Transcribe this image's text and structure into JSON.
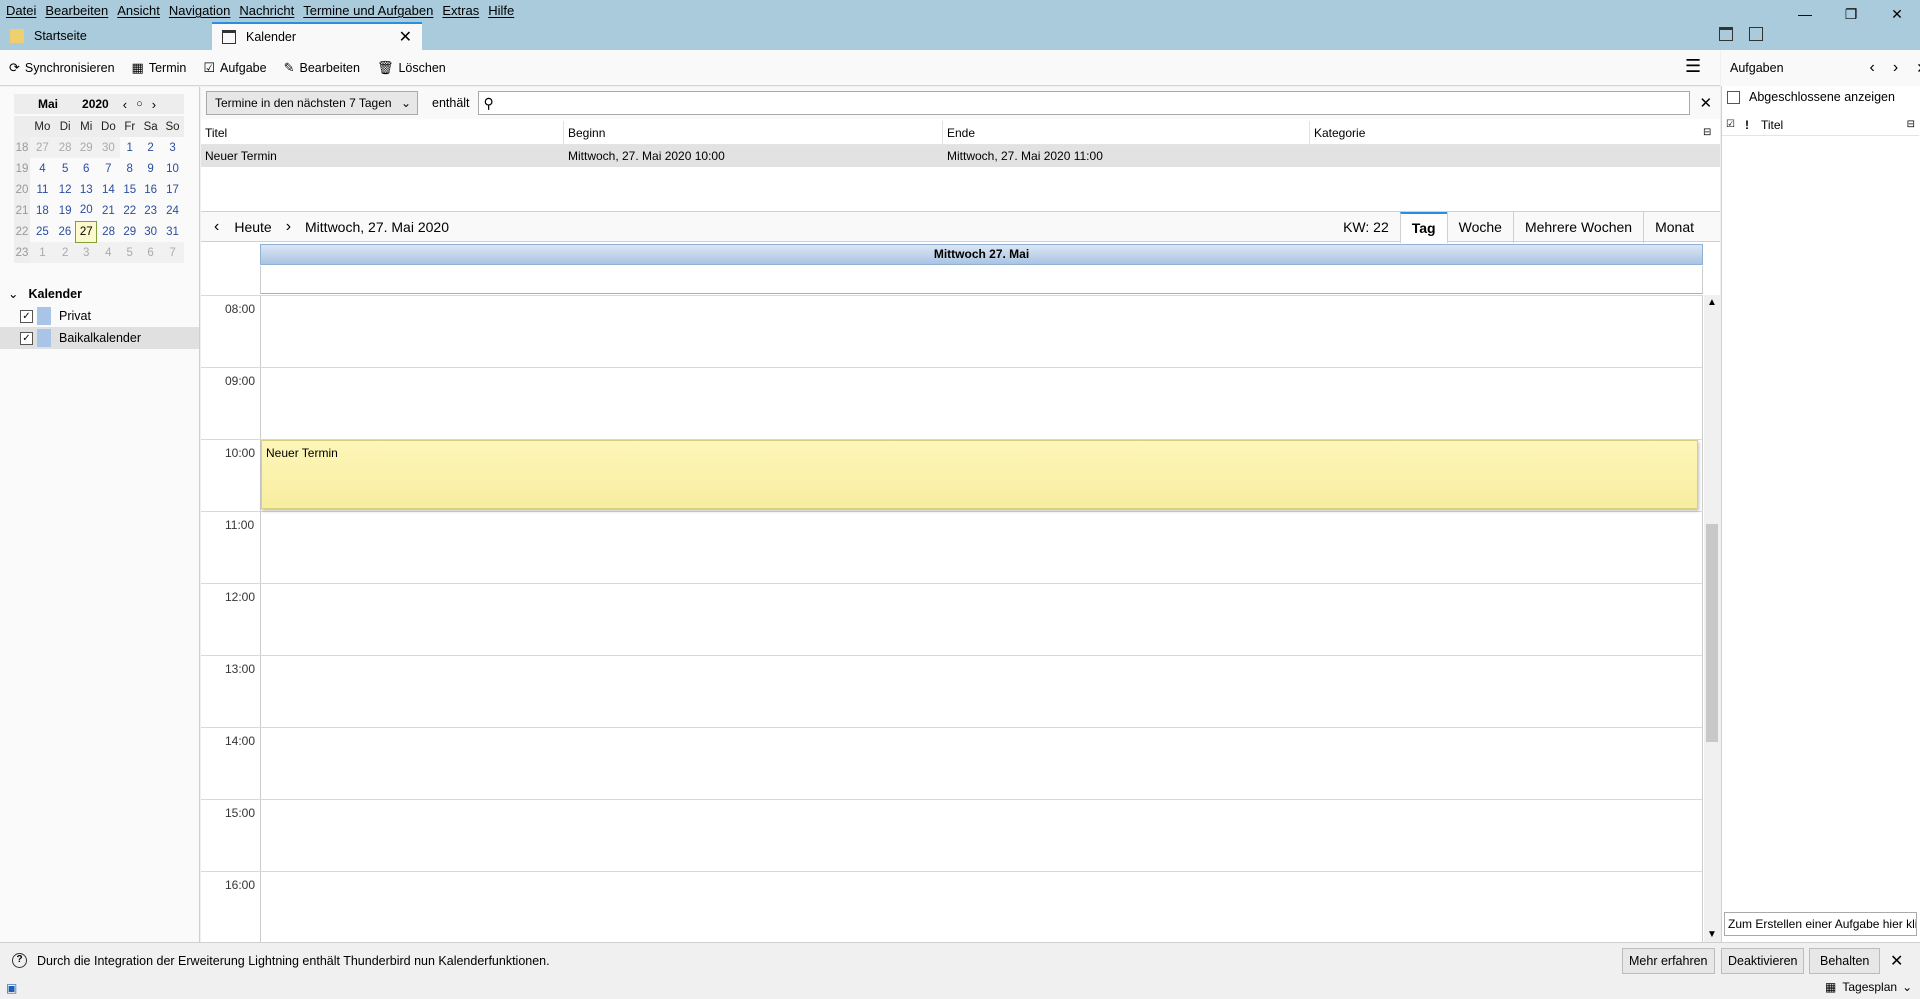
{
  "menu": [
    "Datei",
    "Bearbeiten",
    "Ansicht",
    "Navigation",
    "Nachricht",
    "Termine und Aufgaben",
    "Extras",
    "Hilfe"
  ],
  "tabs": {
    "start": "Startseite",
    "calendar": "Kalender"
  },
  "toolbar": {
    "sync": "Synchronisieren",
    "event": "Termin",
    "task": "Aufgabe",
    "edit": "Bearbeiten",
    "delete": "Löschen"
  },
  "minimonth": {
    "month": "Mai",
    "year": "2020",
    "weekday_headers": [
      "Mo",
      "Di",
      "Mi",
      "Do",
      "Fr",
      "Sa",
      "So"
    ],
    "weeks": [
      {
        "kw": "18",
        "days": [
          "27",
          "28",
          "29",
          "30",
          "1",
          "2",
          "3"
        ]
      },
      {
        "kw": "19",
        "days": [
          "4",
          "5",
          "6",
          "7",
          "8",
          "9",
          "10"
        ]
      },
      {
        "kw": "20",
        "days": [
          "11",
          "12",
          "13",
          "14",
          "15",
          "16",
          "17"
        ]
      },
      {
        "kw": "21",
        "days": [
          "18",
          "19",
          "20",
          "21",
          "22",
          "23",
          "24"
        ]
      },
      {
        "kw": "22",
        "days": [
          "25",
          "26",
          "27",
          "28",
          "29",
          "30",
          "31"
        ]
      },
      {
        "kw": "23",
        "days": [
          "1",
          "2",
          "3",
          "4",
          "5",
          "6",
          "7"
        ]
      }
    ],
    "today": "27"
  },
  "calendars": {
    "heading": "Kalender",
    "items": [
      {
        "name": "Privat",
        "color": "#a8c4e6"
      },
      {
        "name": "Baikalkalender",
        "color": "#a8c4e6"
      }
    ]
  },
  "filter": {
    "selected": "Termine in den nächsten 7 Tagen",
    "contains_label": "enthält",
    "search_value": ""
  },
  "list": {
    "columns": [
      "Titel",
      "Beginn",
      "Ende",
      "Kategorie"
    ],
    "rows": [
      {
        "title": "Neuer Termin",
        "start": "Mittwoch, 27. Mai 2020 10:00",
        "end": "Mittwoch, 27. Mai 2020 11:00",
        "category": ""
      }
    ]
  },
  "nav": {
    "today": "Heute",
    "date": "Mittwoch, 27. Mai 2020",
    "week": "KW: 22",
    "views": [
      "Tag",
      "Woche",
      "Mehrere Wochen",
      "Monat"
    ],
    "active_view": "Tag"
  },
  "day": {
    "header": "Mittwoch 27. Mai",
    "hours": [
      "08:00",
      "09:00",
      "10:00",
      "11:00",
      "12:00",
      "13:00",
      "14:00",
      "15:00",
      "16:00"
    ],
    "event": {
      "title": "Neuer Termin",
      "color": "#fdf6b8"
    }
  },
  "tasks": {
    "title": "Aufgaben",
    "show_completed": "Abgeschlossene anzeigen",
    "column_title": "Titel",
    "new_placeholder": "Zum Erstellen einer Aufgabe hier kli"
  },
  "notification": {
    "text": "Durch die Integration der Erweiterung Lightning enthält Thunderbird nun Kalenderfunktionen.",
    "more": "Mehr erfahren",
    "disable": "Deaktivieren",
    "keep": "Behalten"
  },
  "statusbar": {
    "today_pane": "Tagesplan"
  },
  "colors": {
    "accent": "#2b8de0",
    "titlebar": "#a9cbdc",
    "event": "#fdf6b8"
  }
}
